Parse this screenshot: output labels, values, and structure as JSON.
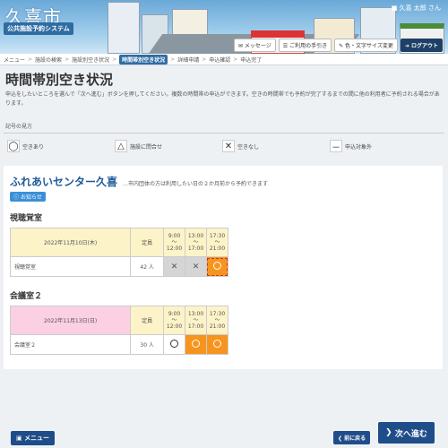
{
  "header": {
    "city_name": "久喜市",
    "system_name": "公共施設予約システム",
    "user_name": "久喜 太郎 さん",
    "buttons": {
      "message": "メッセージ",
      "guide": "ご利用の手引き",
      "text_size": "色・文字サイズ変更",
      "logout": "ログアウト"
    }
  },
  "breadcrumb": [
    "メニュー",
    "施設の検索",
    "施設別空き状況",
    "時間帯別空き状況",
    "詳細申請",
    "申込確認",
    "申込完了"
  ],
  "page": {
    "title": "時間帯別空き状況",
    "intro": "申込をしたいところを選んで「次へ進む」ボタンを押してください。複数の時間帯の申込ができます。空きの時間帯でも予約が完了するまでの間に他の利用者に予約される場合があります。"
  },
  "legend": {
    "title": "記号の見方",
    "items": [
      {
        "symbol": "◯",
        "label": "空きあり"
      },
      {
        "symbol": "△",
        "label": "施設に問合せ"
      },
      {
        "symbol": "✕",
        "label": "空きなし"
      },
      {
        "symbol": "－",
        "label": "申込対象外"
      }
    ]
  },
  "facility": {
    "name": "ふれあいセンター久喜",
    "note": "…市内団体の方は利用したい日の２か月前から予約できます",
    "notice": "お知らせ"
  },
  "rooms": [
    {
      "title": "視聴覚室",
      "date": "2022年11月10日(木)",
      "capacity_header": "定員",
      "slots": [
        {
          "from": "9:00",
          "sep": "～",
          "to": "12:00"
        },
        {
          "from": "13:00",
          "sep": "～",
          "to": "17:00"
        },
        {
          "from": "17:30",
          "sep": "～",
          "to": "21:00"
        }
      ],
      "row_name": "視聴覚室",
      "capacity": "42 人",
      "status": [
        "✕",
        "✕",
        "◯"
      ]
    },
    {
      "title": "会議室２",
      "date": "2022年11月13日(日)",
      "capacity_header": "定員",
      "slots": [
        {
          "from": "9:00",
          "sep": "～",
          "to": "12:00"
        },
        {
          "from": "13:00",
          "sep": "～",
          "to": "17:00"
        },
        {
          "from": "17:30",
          "sep": "～",
          "to": "21:00"
        }
      ],
      "row_name": "会議室２",
      "capacity": "30 人",
      "status": [
        "◯",
        "◯",
        "◯"
      ]
    }
  ],
  "footer": {
    "menu": "メニュー",
    "back": "前に戻る",
    "next": "次へ進む"
  },
  "colors": {
    "accent": "#1e4d8a",
    "available_selected": "#f7941d",
    "unavailable": "#d5d5d5",
    "date_header_room1": "#fdf3c8",
    "date_header_room2": "#fbd0e2"
  }
}
